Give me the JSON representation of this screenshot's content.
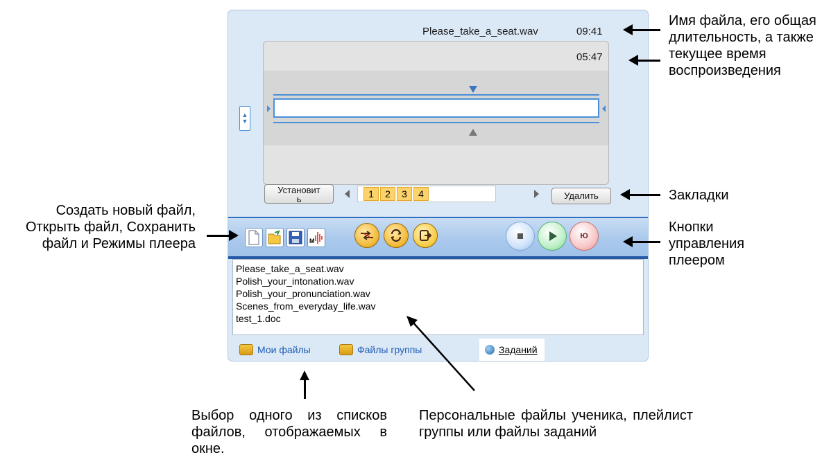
{
  "player": {
    "file_name": "Please_take_a_seat.wav",
    "total_duration": "09:41",
    "current_time": "05:47",
    "set_button": "Установит\nь",
    "bookmarks": [
      "1",
      "2",
      "3",
      "4"
    ],
    "delete_button": "Удалить",
    "toolbar": {
      "file_buttons": [
        "new-file-icon",
        "open-file-icon",
        "save-file-icon",
        "mode-icon"
      ],
      "mode_icon_label": "М",
      "round_buttons": [
        "shuffle-icon",
        "repeat-icon",
        "exit-icon"
      ],
      "control_buttons": [
        "stop-icon",
        "play-icon",
        "record-icon"
      ],
      "record_label": "Ю"
    },
    "files": [
      "Please_take_a_seat.wav",
      "Polish_your_intonation.wav",
      "Polish_your_pronunciation.wav",
      "Scenes_from_everyday_life.wav",
      "test_1.doc"
    ],
    "tabs": [
      "Мои файлы",
      "Файлы группы",
      "Заданий"
    ],
    "colors": {
      "accent": "#2f6fc2",
      "bookmark": "#fcd26a",
      "window_bg": "#dbe8f6"
    }
  },
  "annotations": {
    "filename_note": "Имя файла, его общая длительность, а также текущее время воспроизведения",
    "bookmarks_note": "Закладки",
    "controls_note": "Кнопки управления плеером",
    "file_ops_note": "Создать новый файл, Открыть файл, Сохранить файл и Режимы плеера",
    "tabs_note": "Выбор одного из списков файлов, отображаемых в окне.",
    "list_note": "Персональные файлы ученика, плейлист группы или файлы заданий"
  }
}
